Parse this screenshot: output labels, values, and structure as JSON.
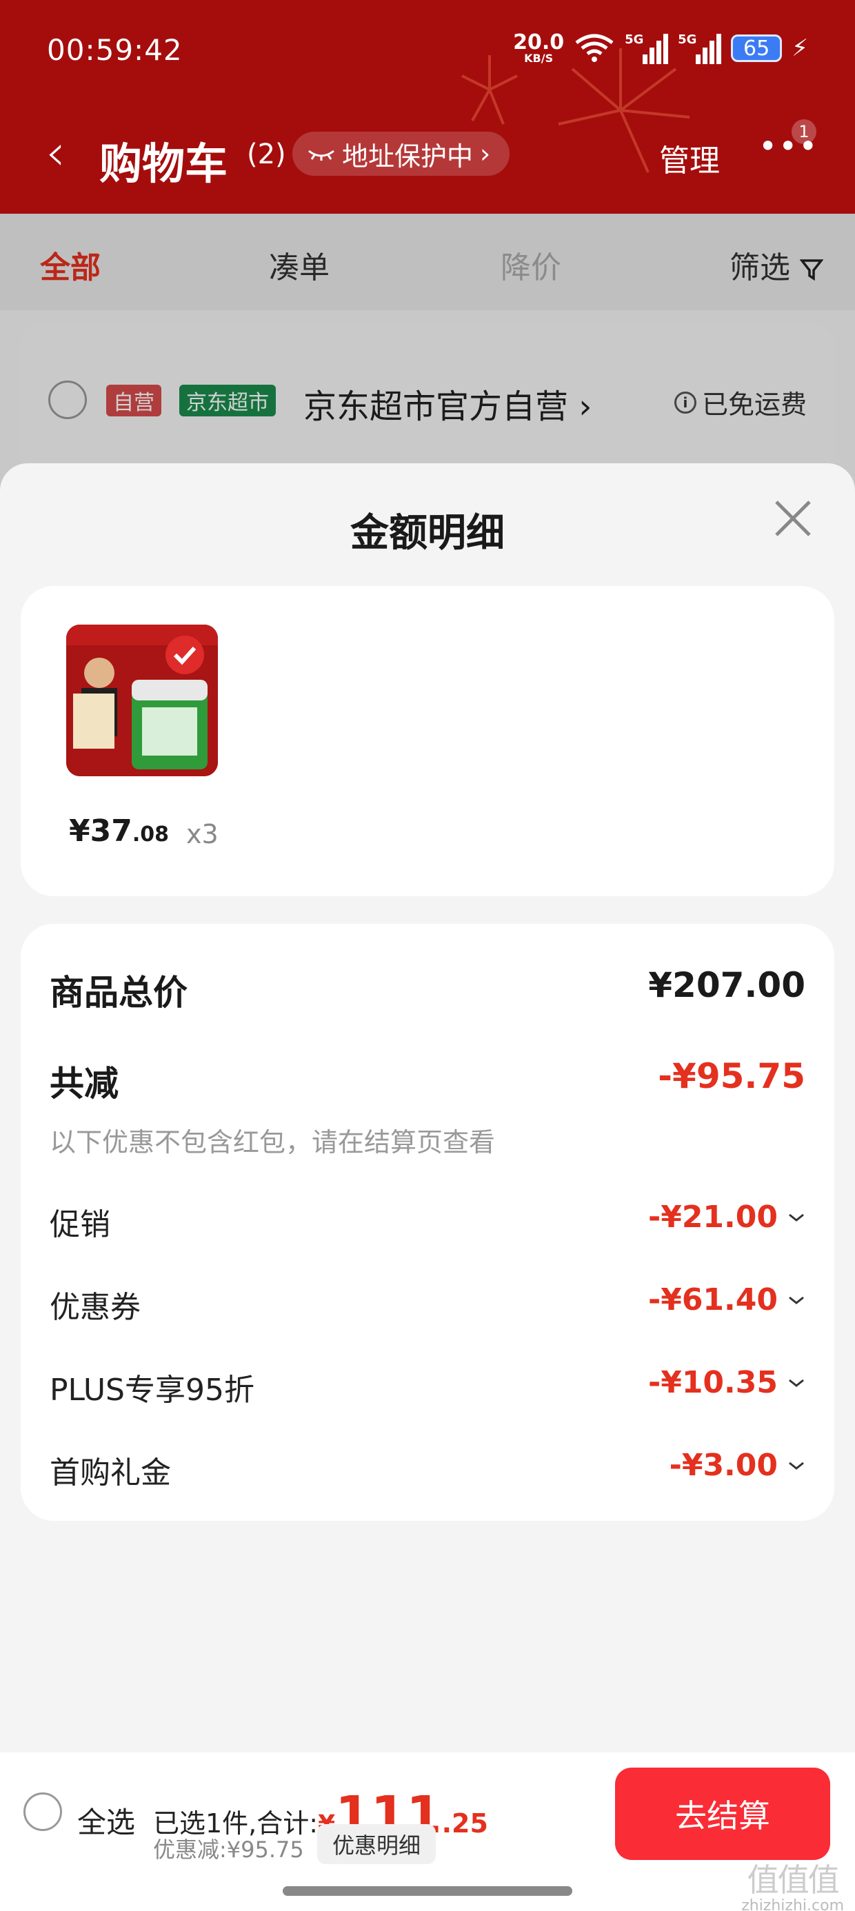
{
  "status_bar": {
    "time": "00:59:42",
    "net_speed": "20.0",
    "net_unit": "KB/S",
    "sig1": "5G",
    "sig2": "5G",
    "battery": "65"
  },
  "header": {
    "title": "购物车",
    "count": "(2)",
    "address_pill": "地址保护中",
    "manage": "管理",
    "message_badge": "1"
  },
  "tabs": [
    "全部",
    "凑单",
    "降价",
    "筛选"
  ],
  "shop": {
    "tag_self": "自营",
    "tag_market": "京东超市",
    "name": "京东超市官方自营",
    "shipping": "已免运费"
  },
  "sheet": {
    "title": "金额明细",
    "product": {
      "price_int": "¥37",
      "price_dec": ".08",
      "quantity": "x3"
    },
    "summary": {
      "total_label": "商品总价",
      "total_value": "¥207.00",
      "reduce_label": "共减",
      "reduce_value": "-¥95.75",
      "note": "以下优惠不包含红包，请在结算页查看",
      "items": [
        {
          "label": "促销",
          "value": "-¥21.00"
        },
        {
          "label": "优惠券",
          "value": "-¥61.40"
        },
        {
          "label": "PLUS专享95折",
          "value": "-¥10.35"
        },
        {
          "label": "首购礼金",
          "value": "-¥3.00"
        }
      ]
    }
  },
  "bottom_bar": {
    "select_all": "全选",
    "selected_text": "已选1件,合计:",
    "total_symbol": "¥",
    "total_int": "111",
    "total_dec": ".25",
    "discount": "优惠减:¥95.75",
    "detail_button": "优惠明细",
    "checkout": "去结算"
  },
  "watermark": {
    "logo": "值值值",
    "url": "zhizhizhi.com"
  },
  "colors": {
    "header_red": "#a50d0d",
    "accent_red": "#e4301e",
    "checkout_red": "#fa2c36",
    "market_green": "#1a8c4e"
  }
}
